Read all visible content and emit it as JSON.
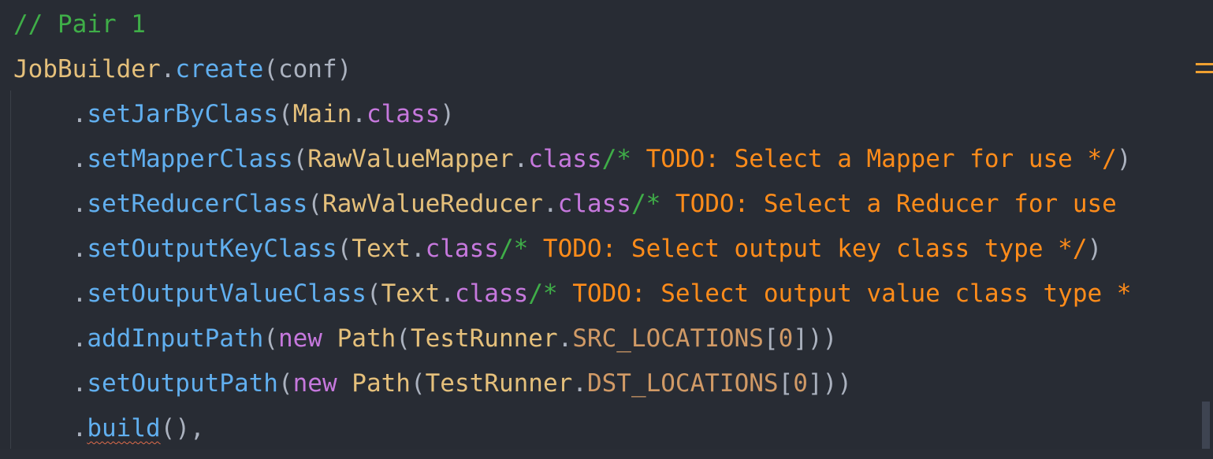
{
  "colors": {
    "background": "#282c34",
    "comment": "#3fae48",
    "class": "#e5c07b",
    "method": "#61afef",
    "keyword": "#c678dd",
    "todo": "#ff8c1a",
    "field": "#d19a66",
    "punctuation": "#abb2bf",
    "warning_marker": "#f0a030"
  },
  "code": {
    "l1": {
      "comment": "// Pair 1"
    },
    "l2": {
      "cls": "JobBuilder",
      "dot": ".",
      "method": "create",
      "args": "(conf)"
    },
    "l3": {
      "indent": "    ",
      "dot": ".",
      "method": "setJarByClass",
      "open": "(",
      "cls": "Main",
      "dot2": ".",
      "kw": "class",
      "close": ")"
    },
    "l4": {
      "indent": "    ",
      "dot": ".",
      "method": "setMapperClass",
      "open": "(",
      "cls": "RawValueMapper",
      "dot2": ".",
      "kw": "class",
      "comment_open": "/*",
      "todo": " TODO: Select a Mapper for use ",
      "comment_close": "*/",
      "close": ")"
    },
    "l5": {
      "indent": "    ",
      "dot": ".",
      "method": "setReducerClass",
      "open": "(",
      "cls": "RawValueReducer",
      "dot2": ".",
      "kw": "class",
      "comment_open": "/*",
      "todo": " TODO: Select a Reducer for use"
    },
    "l6": {
      "indent": "    ",
      "dot": ".",
      "method": "setOutputKeyClass",
      "open": "(",
      "cls": "Text",
      "dot2": ".",
      "kw": "class",
      "comment_open": "/*",
      "todo": " TODO: Select output key class type ",
      "comment_close": "*/",
      "close": ")"
    },
    "l7": {
      "indent": "    ",
      "dot": ".",
      "method": "setOutputValueClass",
      "open": "(",
      "cls": "Text",
      "dot2": ".",
      "kw": "class",
      "comment_open": "/*",
      "todo": " TODO: Select output value class type *"
    },
    "l8": {
      "indent": "    ",
      "dot": ".",
      "method": "addInputPath",
      "open": "(",
      "kw": "new",
      "cls": " Path",
      "open2": "(",
      "cls2": "TestRunner",
      "dot2": ".",
      "field": "SRC_LOCATIONS",
      "open3": "[",
      "num": "0",
      "close": "]))"
    },
    "l9": {
      "indent": "    ",
      "dot": ".",
      "method": "setOutputPath",
      "open": "(",
      "kw": "new",
      "cls": " Path",
      "open2": "(",
      "cls2": "TestRunner",
      "dot2": ".",
      "field": "DST_LOCATIONS",
      "open3": "[",
      "num": "0",
      "close": "]))"
    },
    "l10": {
      "indent": "    ",
      "dot": ".",
      "method": "build",
      "close": "(),"
    }
  }
}
